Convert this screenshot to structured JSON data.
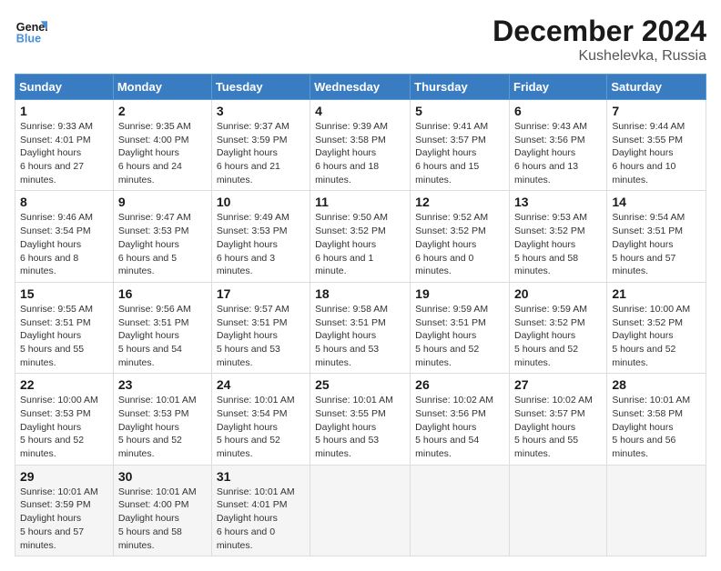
{
  "header": {
    "logo_line1": "General",
    "logo_line2": "Blue",
    "month_year": "December 2024",
    "location": "Kushelevka, Russia"
  },
  "calendar": {
    "days_of_week": [
      "Sunday",
      "Monday",
      "Tuesday",
      "Wednesday",
      "Thursday",
      "Friday",
      "Saturday"
    ],
    "weeks": [
      [
        null,
        {
          "day": 2,
          "sunrise": "9:35 AM",
          "sunset": "4:00 PM",
          "daylight": "6 hours and 24 minutes."
        },
        {
          "day": 3,
          "sunrise": "9:37 AM",
          "sunset": "3:59 PM",
          "daylight": "6 hours and 21 minutes."
        },
        {
          "day": 4,
          "sunrise": "9:39 AM",
          "sunset": "3:58 PM",
          "daylight": "6 hours and 18 minutes."
        },
        {
          "day": 5,
          "sunrise": "9:41 AM",
          "sunset": "3:57 PM",
          "daylight": "6 hours and 15 minutes."
        },
        {
          "day": 6,
          "sunrise": "9:43 AM",
          "sunset": "3:56 PM",
          "daylight": "6 hours and 13 minutes."
        },
        {
          "day": 7,
          "sunrise": "9:44 AM",
          "sunset": "3:55 PM",
          "daylight": "6 hours and 10 minutes."
        }
      ],
      [
        {
          "day": 1,
          "sunrise": "9:33 AM",
          "sunset": "4:01 PM",
          "daylight": "6 hours and 27 minutes."
        },
        {
          "day": 9,
          "sunrise": "9:47 AM",
          "sunset": "3:53 PM",
          "daylight": "6 hours and 5 minutes."
        },
        {
          "day": 10,
          "sunrise": "9:49 AM",
          "sunset": "3:53 PM",
          "daylight": "6 hours and 3 minutes."
        },
        {
          "day": 11,
          "sunrise": "9:50 AM",
          "sunset": "3:52 PM",
          "daylight": "6 hours and 1 minute."
        },
        {
          "day": 12,
          "sunrise": "9:52 AM",
          "sunset": "3:52 PM",
          "daylight": "6 hours and 0 minutes."
        },
        {
          "day": 13,
          "sunrise": "9:53 AM",
          "sunset": "3:52 PM",
          "daylight": "5 hours and 58 minutes."
        },
        {
          "day": 14,
          "sunrise": "9:54 AM",
          "sunset": "3:51 PM",
          "daylight": "5 hours and 57 minutes."
        }
      ],
      [
        {
          "day": 8,
          "sunrise": "9:46 AM",
          "sunset": "3:54 PM",
          "daylight": "6 hours and 8 minutes."
        },
        {
          "day": 16,
          "sunrise": "9:56 AM",
          "sunset": "3:51 PM",
          "daylight": "5 hours and 54 minutes."
        },
        {
          "day": 17,
          "sunrise": "9:57 AM",
          "sunset": "3:51 PM",
          "daylight": "5 hours and 53 minutes."
        },
        {
          "day": 18,
          "sunrise": "9:58 AM",
          "sunset": "3:51 PM",
          "daylight": "5 hours and 53 minutes."
        },
        {
          "day": 19,
          "sunrise": "9:59 AM",
          "sunset": "3:51 PM",
          "daylight": "5 hours and 52 minutes."
        },
        {
          "day": 20,
          "sunrise": "9:59 AM",
          "sunset": "3:52 PM",
          "daylight": "5 hours and 52 minutes."
        },
        {
          "day": 21,
          "sunrise": "10:00 AM",
          "sunset": "3:52 PM",
          "daylight": "5 hours and 52 minutes."
        }
      ],
      [
        {
          "day": 15,
          "sunrise": "9:55 AM",
          "sunset": "3:51 PM",
          "daylight": "5 hours and 55 minutes."
        },
        {
          "day": 23,
          "sunrise": "10:01 AM",
          "sunset": "3:53 PM",
          "daylight": "5 hours and 52 minutes."
        },
        {
          "day": 24,
          "sunrise": "10:01 AM",
          "sunset": "3:54 PM",
          "daylight": "5 hours and 52 minutes."
        },
        {
          "day": 25,
          "sunrise": "10:01 AM",
          "sunset": "3:55 PM",
          "daylight": "5 hours and 53 minutes."
        },
        {
          "day": 26,
          "sunrise": "10:02 AM",
          "sunset": "3:56 PM",
          "daylight": "5 hours and 54 minutes."
        },
        {
          "day": 27,
          "sunrise": "10:02 AM",
          "sunset": "3:57 PM",
          "daylight": "5 hours and 55 minutes."
        },
        {
          "day": 28,
          "sunrise": "10:01 AM",
          "sunset": "3:58 PM",
          "daylight": "5 hours and 56 minutes."
        }
      ],
      [
        {
          "day": 22,
          "sunrise": "10:00 AM",
          "sunset": "3:53 PM",
          "daylight": "5 hours and 52 minutes."
        },
        {
          "day": 30,
          "sunrise": "10:01 AM",
          "sunset": "4:00 PM",
          "daylight": "5 hours and 58 minutes."
        },
        {
          "day": 31,
          "sunrise": "10:01 AM",
          "sunset": "4:01 PM",
          "daylight": "6 hours and 0 minutes."
        },
        null,
        null,
        null,
        null
      ],
      [
        {
          "day": 29,
          "sunrise": "10:01 AM",
          "sunset": "3:59 PM",
          "daylight": "5 hours and 57 minutes."
        },
        null,
        null,
        null,
        null,
        null,
        null
      ]
    ]
  }
}
